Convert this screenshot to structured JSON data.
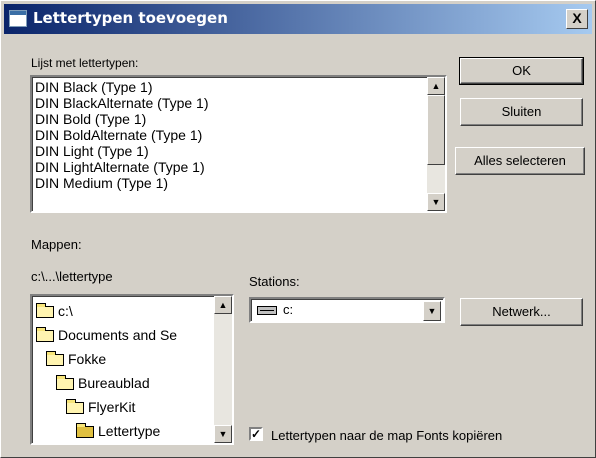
{
  "window": {
    "title": "Lettertypen toevoegen",
    "close_glyph": "X"
  },
  "fonts_section": {
    "label": "Lijst met lettertypen:",
    "items": [
      "DIN Black (Type 1)",
      "DIN BlackAlternate (Type 1)",
      "DIN Bold (Type 1)",
      "DIN BoldAlternate (Type 1)",
      "DIN Light (Type 1)",
      "DIN LightAlternate (Type 1)",
      "DIN Medium (Type 1)"
    ]
  },
  "buttons": {
    "ok": "OK",
    "close": "Sluiten",
    "select_all": "Alles selecteren",
    "network": "Netwerk..."
  },
  "folders_section": {
    "label": "Mappen:",
    "current_path": "c:\\...\\lettertype",
    "items": [
      "c:\\",
      "Documents and Se",
      "Fokke",
      "Bureaublad",
      "FlyerKit",
      "Lettertype"
    ]
  },
  "drives_section": {
    "label": "Stations:",
    "selected": "c:"
  },
  "copy_option": {
    "label": "Lettertypen naar de map Fonts kopiëren",
    "checked": true,
    "check_glyph": "✓"
  },
  "icons": [
    "close-icon",
    "folder-icon",
    "drive-icon",
    "scroll-up-icon",
    "scroll-down-icon",
    "dropdown-arrow-icon",
    "checkmark-icon"
  ]
}
